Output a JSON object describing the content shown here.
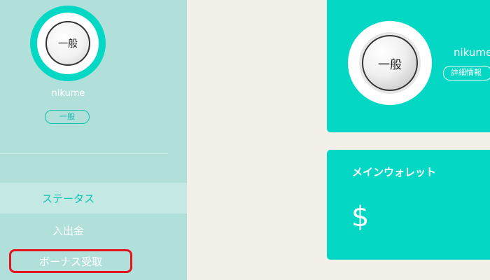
{
  "sidebar": {
    "avatar_rank": "一般",
    "username": "nikume",
    "rank_badge": "一般",
    "nav": {
      "status": "ステータス",
      "deposit": "入出金",
      "bonus": "ボーナス受取"
    }
  },
  "profile_card": {
    "avatar_rank": "一般",
    "username": "nikume",
    "detail_button": "詳細情報"
  },
  "wallet_card": {
    "title": "メインウォレット",
    "currency_symbol": "$"
  },
  "colors": {
    "sidebar_bg": "#b1dfda",
    "accent": "#04d8c5",
    "page_bg": "#f3f0ea",
    "highlight_border": "#e3141e"
  }
}
